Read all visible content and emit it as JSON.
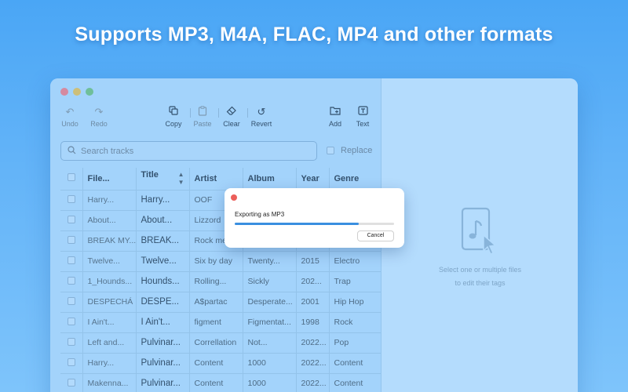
{
  "headline": "Supports MP3, M4A, FLAC, MP4 and other formats",
  "toolbar": {
    "undo": "Undo",
    "redo": "Redo",
    "copy": "Copy",
    "paste": "Paste",
    "clear": "Clear",
    "revert": "Revert",
    "add": "Add",
    "text": "Text"
  },
  "search": {
    "placeholder": "Search tracks"
  },
  "replace_label": "Replace",
  "table": {
    "columns": [
      "File...",
      "Title",
      "Artist",
      "Album",
      "Year",
      "Genre"
    ],
    "rows": [
      [
        "Harry...",
        "Harry...",
        "OOF",
        "",
        "",
        ""
      ],
      [
        "About...",
        "About...",
        "Lizzord",
        "",
        "",
        ""
      ],
      [
        "BREAK MY...",
        "BREAK...",
        "Rock me",
        "",
        "",
        ""
      ],
      [
        "Twelve...",
        "Twelve...",
        "Six by day",
        "Twenty...",
        "2015",
        "Electro"
      ],
      [
        "1_Hounds...",
        "Hounds...",
        "Rolling...",
        "Sickly",
        "202...",
        "Trap"
      ],
      [
        "DESPECHÁ",
        "DESPE...",
        "A$partac",
        "Desperate...",
        "2001",
        "Hip Hop"
      ],
      [
        "I Ain't...",
        "I Ain't...",
        "figment",
        "Figmentat...",
        "1998",
        "Rock"
      ],
      [
        "Left and...",
        "Pulvinar...",
        "Correllation",
        "Not...",
        "2022...",
        "Pop"
      ],
      [
        "Harry...",
        "Pulvinar...",
        "Content",
        "1000",
        "2022...",
        "Content"
      ],
      [
        "Makenna...",
        "Pulvinar...",
        "Content",
        "1000",
        "2022...",
        "Content"
      ]
    ]
  },
  "dialog": {
    "title": "Exporting as MP3",
    "progress": 0.78,
    "cancel": "Cancel"
  },
  "right_pane": {
    "line1": "Select one or multiple files",
    "line2": "to edit their tags"
  },
  "colors": {
    "accent": "#3a8fe0",
    "close": "#ec5f5a"
  }
}
